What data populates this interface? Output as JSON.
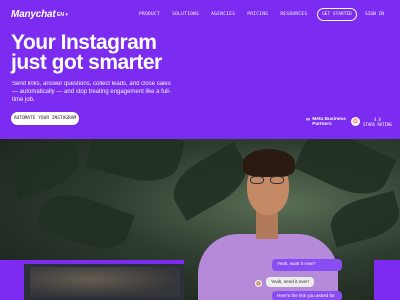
{
  "header": {
    "logo": "Manychat",
    "lang": "EN ▾",
    "nav": [
      "PRODUCT",
      "SOLUTIONS",
      "AGENCIES",
      "PRICING",
      "RESOURCES"
    ],
    "get_started": "GET STARTED",
    "sign_in": "SIGN IN"
  },
  "hero": {
    "title_line1": "Your Instagram",
    "title_line2": "just got smarter",
    "subtitle": "Send links, answer questions, collect leads, and close sales — automatically — and stop treating engagement like a full-time job.",
    "cta": "AUTOMATE YOUR INSTAGRAM"
  },
  "badges": {
    "meta_icon": "∞",
    "meta_line1": "Meta Business",
    "meta_line2": "Partners",
    "g2_icon": "G",
    "rating_value": "4.6",
    "rating_label": "STARS RATING"
  },
  "chat": {
    "msg1": "Yeah, want it now?",
    "msg2": "Yeah, send it over!",
    "msg3": "Here's the link you asked for"
  },
  "colors": {
    "brand_purple": "#7b2cf0",
    "chat_purple": "#8a4cf3",
    "g2_red": "#ff492c"
  }
}
